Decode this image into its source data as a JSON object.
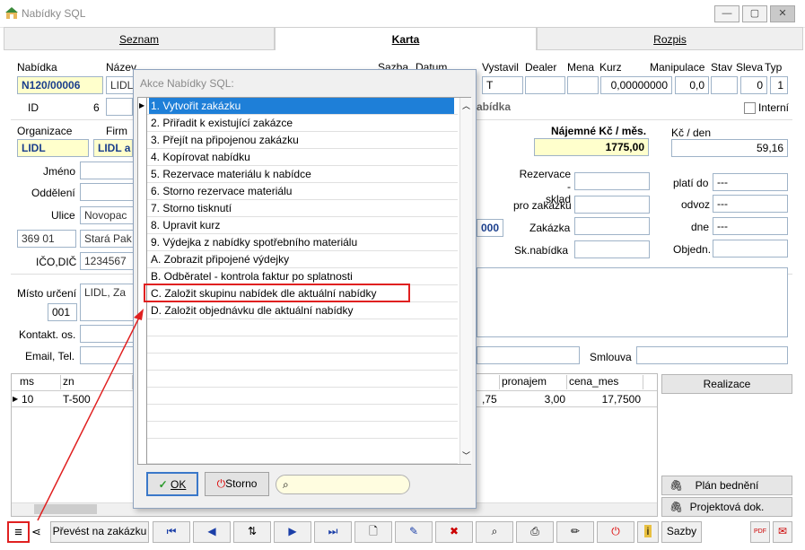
{
  "window": {
    "title": "Nabídky SQL"
  },
  "tabs": [
    {
      "label": "Seznam"
    },
    {
      "label": "Karta"
    },
    {
      "label": "Rozpis"
    }
  ],
  "header_labels": {
    "nabidka": "Nabídka",
    "nazev": "Název",
    "sazba": "Sazba",
    "datum": "Datum",
    "vystavil": "Vystavil",
    "dealer": "Dealer",
    "mena": "Mena",
    "kurz": "Kurz",
    "manipulace": "Manipulace",
    "stav": "Stav",
    "sleva": "Sleva",
    "typ": "Typ"
  },
  "header_values": {
    "nabidka": "N120/00006",
    "nazev": "LIDL",
    "vystavil": "T",
    "kurz": "0,00000000",
    "manipulace": "0,0",
    "sleva": "0",
    "typ": "1"
  },
  "id_row": {
    "id_label": "ID",
    "id_value": "6",
    "status_text": "abídka",
    "interni_label": "Interní"
  },
  "org": {
    "organizace_label": "Organizace",
    "firma_label": "Firm",
    "organizace_value": "LIDL",
    "firma_value": "LIDL a"
  },
  "najem": {
    "label": "Nájemné Kč / měs.",
    "value": "1775,00",
    "kc_den_label": "Kč / den",
    "kc_den_value": "59,16"
  },
  "contact_labels": {
    "jmeno": "Jméno",
    "oddeleni": "Oddělení",
    "ulice": "Ulice",
    "ico": "IČO,DIČ",
    "misto": "Místo určení",
    "kontakt": "Kontakt. os.",
    "email": "Email, Tel."
  },
  "contact_values": {
    "ulice": "Novopac",
    "psc": "369 01",
    "mesto": "Stará Pak",
    "ico": "1234567",
    "misto": "LIDL, Za",
    "misto_code": "001",
    "amount": "000"
  },
  "right_labels": {
    "rezervace": "Rezervace -\nsklad",
    "pro_zakazku": "pro zakázku",
    "zakazka": "Zakázka",
    "sknabidka": "Sk.nabídka",
    "plati_do": "platí do",
    "odvoz": "odvoz",
    "dne": "dne",
    "objedn": "Objedn.",
    "smlouva": "Smlouva"
  },
  "right_values": {
    "plati_do": "---",
    "odvoz": "---",
    "dne": "---"
  },
  "grid": {
    "headers": [
      "ms",
      "zn",
      "pronajem",
      "cena_mes"
    ],
    "row": {
      "ms": "10",
      "zn": "T-500",
      "partial": ",75",
      "pronajem": "3,00",
      "cena_mes": "17,7500"
    }
  },
  "side_buttons": {
    "realizace": "Realizace",
    "plan": "Plán bednění",
    "projekt": "Projektová dok."
  },
  "toolbar": {
    "prevest": "Převést na zakázku",
    "sazby": "Sazby"
  },
  "dialog": {
    "title": "Akce Nabídky SQL:",
    "items": [
      "1. Vytvořit zakázku",
      "2. Přiřadit k existující zakázce",
      "3. Přejít na připojenou zakázku",
      "4. Kopírovat nabídku",
      "5. Rezervace materiálu k nabídce",
      "6. Storno rezervace materiálu",
      "7. Storno tisknutí",
      "8. Upravit kurz",
      "9. Výdejka z nabídky spotřebního materiálu",
      "A. Zobrazit připojené výdejky",
      "B. Odběratel - kontrola faktur po splatnosti",
      "C. Založit skupinu nabídek dle aktuální nabídky",
      "D. Založit objednávku dle aktuální nabídky"
    ],
    "ok_label": "OK",
    "storno_label": "Storno",
    "search_value": ""
  },
  "colors": {
    "selection": "#1e7fd8",
    "highlight_box": "#e02020",
    "accent_yellow": "#ffffcc"
  }
}
